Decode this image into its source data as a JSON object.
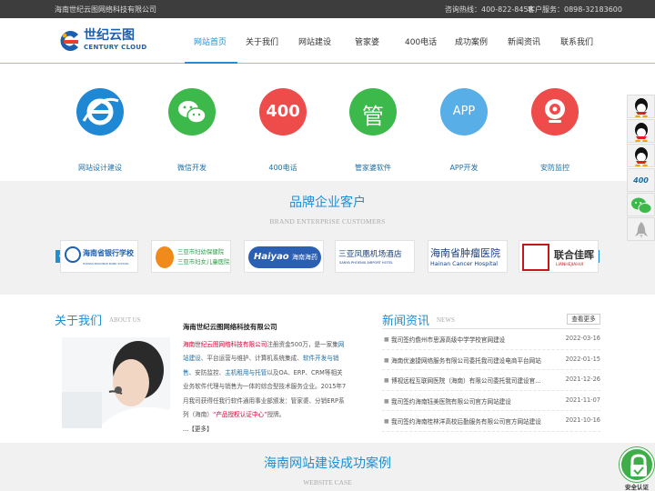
{
  "topbar": {
    "company": "海南世纪云图网络科技有限公司",
    "hotline": "咨询热线：400-822-8458",
    "service": "客户服务：0898-32183600"
  },
  "logo": {
    "cn": "世纪云图",
    "en": "CENTURY CLOUD"
  },
  "nav": {
    "items": [
      "网站首页",
      "关于我们",
      "网站建设",
      "管家婆",
      "400电话",
      "成功案例",
      "新闻资讯",
      "联系我们"
    ],
    "active": "网站首页"
  },
  "services": [
    {
      "label": "网站设计建设",
      "icon": "ie-browser-icon",
      "color": "#1e88d4"
    },
    {
      "label": "微信开发",
      "icon": "wechat-icon",
      "color": "#3cb94a"
    },
    {
      "label": "400电话",
      "icon": "400-icon",
      "color": "#ee4b4b",
      "glyph": "400"
    },
    {
      "label": "管家婆软件",
      "icon": "guanjiapo-icon",
      "color": "#3cb94a",
      "glyph": "管"
    },
    {
      "label": "APP开发",
      "icon": "app-icon",
      "color": "#58aee6",
      "glyph": "APP"
    },
    {
      "label": "安防监控",
      "icon": "camera-icon",
      "color": "#ee4b4b"
    }
  ],
  "brands": {
    "title": "品牌企业客户",
    "subtitle": "BRAND ENTERPRISE CUSTOMERS",
    "logos": [
      {
        "name": "海南省银行学校",
        "sub": "HAINAN PROVINCE BANK SCHOOL"
      },
      {
        "name": "三亚市妇幼保健院",
        "sub": "三亚市妇女儿童医院"
      },
      {
        "name": "Haiyao",
        "sub": "海南海药"
      },
      {
        "name": "三亚凤凰机场酒店",
        "sub": "SANYA PHOENIX AIRPORT HOTEL"
      },
      {
        "name": "海南省肿瘤医院",
        "sub": "Hainan Cancer Hospital"
      },
      {
        "name": "联合佳晖",
        "sub": "LIANHEJIAHUI"
      }
    ]
  },
  "about": {
    "title": "关于我们",
    "title_en": "ABOUT US",
    "company": "海南世纪云图网络科技有限公司",
    "p1_hl": "海南世纪云图网络科技有限公司",
    "p1_a": "注册资金500万，是一家集",
    "p1_b": "网站建设",
    "p1_c": "、平台运营与维护、计算机系统集成、",
    "p1_d": "软件开发与销售",
    "p1_e": "、安防监控、",
    "p1_f": "主机租用与托管",
    "p1_g": "以及OA、ERP、CRM等相关业务软件代理与销售为一体的综合型技术服务企业。2015年7月我司获得任我行软件通用事业部颁发：管家婆、分销ERP系列（海南）",
    "p1_h": "“产品授权认证中心”",
    "p1_i": "授牌。",
    "more": "...【更多】"
  },
  "news": {
    "title": "新闻资讯",
    "title_en": "NEWS",
    "more": "查看更多",
    "items": [
      {
        "title": "我司签约儋州市思源高级中学学校官网建设",
        "date": "2022-03-16"
      },
      {
        "title": "海南优速捷网络服务有限公司委托我司建设电商平台网站",
        "date": "2022-01-15"
      },
      {
        "title": "博视远程互联网医院（海南）有限公司委托我司建设官...",
        "date": "2021-12-26"
      },
      {
        "title": "我司签约海南钰美医院有限公司官方网站建设",
        "date": "2021-11-07"
      },
      {
        "title": "我司签约海南桂林洋高校后勤服务有限公司官方网站建设",
        "date": "2021-10-16"
      }
    ]
  },
  "cases": {
    "title": "海南网站建设成功案例",
    "subtitle": "WEBSITE CASE"
  },
  "sidebar": {
    "items": [
      "qq-icon",
      "qq-icon",
      "qq-icon",
      "400-phone-icon",
      "wechat-icon",
      "rocket-icon"
    ],
    "label_400": "400"
  },
  "seal": {
    "label": "安全认证"
  }
}
